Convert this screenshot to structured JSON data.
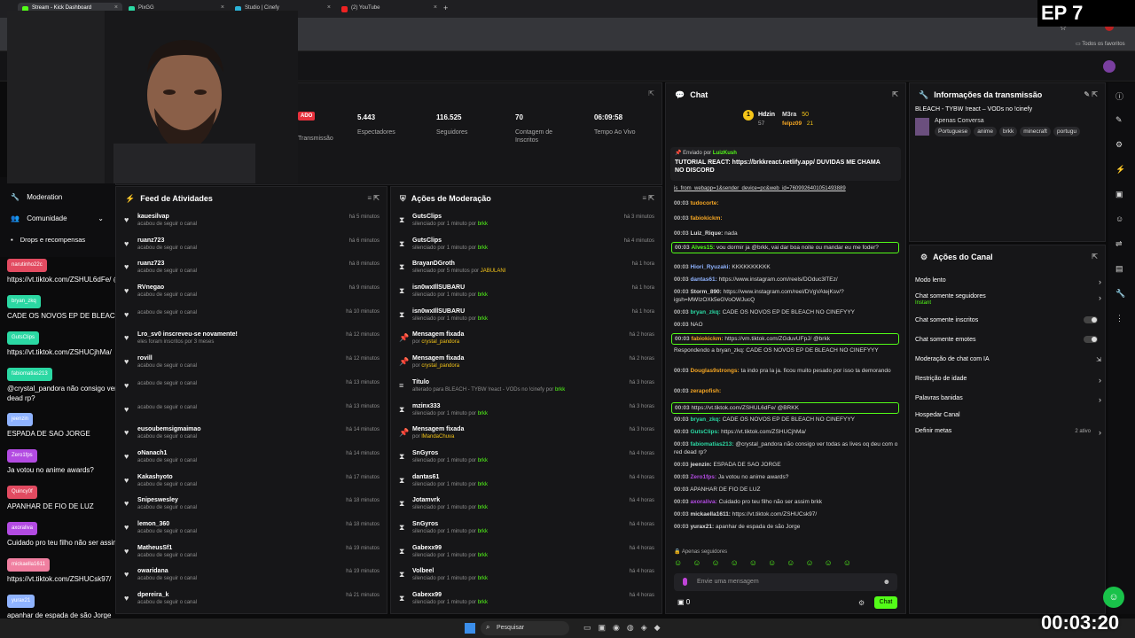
{
  "browser": {
    "tabs": [
      "Stream - Kick Dashboard",
      "PixGG",
      "Studio | Cinefy",
      "(2) YouTube"
    ],
    "bookmarks_label": "Todos os favoritos"
  },
  "overlay": {
    "episode": "EP 7",
    "timer": "00:03:20"
  },
  "stats": [
    {
      "value": "",
      "label": "Transmissão"
    },
    {
      "value": "5.443",
      "label": "Espectadores"
    },
    {
      "value": "116.525",
      "label": "Seguidores"
    },
    {
      "value": "70",
      "label": "Contagem de Inscritos"
    },
    {
      "value": "06:09:58",
      "label": "Tempo Ao Vivo"
    }
  ],
  "live_badge": "ADO",
  "left_nav": [
    {
      "label": "Moderation"
    },
    {
      "label": "Comunidade"
    },
    {
      "label": "Drops e recompensas"
    }
  ],
  "left_chat": [
    {
      "user": "narutinho22c",
      "msg": "https://vt.tiktok.com/ZSHUL6dFe/ @BRKK",
      "color": "#e24b61"
    },
    {
      "user": "bryan_zkq",
      "msg": "CADE OS NOVOS EP DE BLEACH NO CINEFYYY",
      "color": "#2bd8a3"
    },
    {
      "user": "GutsClips",
      "msg": "https://vt.tiktok.com/ZSHUCjhMa/",
      "color": "#2bd8a3"
    },
    {
      "user": "fabiomatias213",
      "msg": "@crystal_pandora não consigo ver todas as lives oq deu com o red dead rp?",
      "color": "#2bd8a3"
    },
    {
      "user": "jeenzin",
      "msg": "ESPADA DE SAO JORGE",
      "color": "#8fb3ff"
    },
    {
      "user": "Zero1fps",
      "msg": "Ja votou no anime awards?",
      "color": "#b34be2"
    },
    {
      "user": "Quincy0f",
      "msg": "APANHAR DE FIO DE LUZ",
      "color": "#e24b61"
    },
    {
      "user": "axoraliva",
      "msg": "Cuidado pro teu filho não ser assim brkk",
      "color": "#b34be2"
    },
    {
      "user": "mickaella1611",
      "msg": "https://vt.tiktok.com/ZSHUCsk97/",
      "color": "#f07fa0"
    },
    {
      "user": "yurax21",
      "msg": "apanhar de espada de são Jorge",
      "color": "#8fb3ff"
    }
  ],
  "feed": {
    "title": "Feed de Atividades",
    "items": [
      {
        "name": "kauesilvap",
        "sub": "acabou de seguir o canal",
        "time": "há 5 minutos"
      },
      {
        "name": "ruanz723",
        "sub": "acabou de seguir o canal",
        "time": "há 6 minutos"
      },
      {
        "name": "ruanz723",
        "sub": "acabou de seguir o canal",
        "time": "há 8 minutos"
      },
      {
        "name": "RVnegao",
        "sub": "acabou de seguir o canal",
        "time": "há 9 minutos"
      },
      {
        "name": "",
        "sub": "acabou de seguir o canal",
        "time": "há 10 minutos"
      },
      {
        "name": "Lro_sv0 inscreveu-se novamente!",
        "sub": "eles foram inscritos por 3 meses",
        "time": "há 12 minutos"
      },
      {
        "name": "rovill",
        "sub": "acabou de seguir o canal",
        "time": "há 12 minutos"
      },
      {
        "name": "",
        "sub": "acabou de seguir o canal",
        "time": "há 13 minutos"
      },
      {
        "name": "",
        "sub": "acabou de seguir o canal",
        "time": "há 13 minutos"
      },
      {
        "name": "eusoubemsigmaimao",
        "sub": "acabou de seguir o canal",
        "time": "há 14 minutos"
      },
      {
        "name": "oNanach1",
        "sub": "acabou de seguir o canal",
        "time": "há 14 minutos"
      },
      {
        "name": "Kakashyoto",
        "sub": "acabou de seguir o canal",
        "time": "há 17 minutos"
      },
      {
        "name": "Snipeswesley",
        "sub": "acabou de seguir o canal",
        "time": "há 18 minutos"
      },
      {
        "name": "lemon_360",
        "sub": "acabou de seguir o canal",
        "time": "há 18 minutos"
      },
      {
        "name": "MatheusSf1",
        "sub": "acabou de seguir o canal",
        "time": "há 19 minutos"
      },
      {
        "name": "owaridana",
        "sub": "acabou de seguir o canal",
        "time": "há 19 minutos"
      },
      {
        "name": "dpereira_k",
        "sub": "acabou de seguir o canal",
        "time": "há 21 minutos"
      }
    ]
  },
  "moderation": {
    "title": "Ações de Moderação",
    "items": [
      {
        "name": "GutsClips",
        "sub": "silenciado por 1 minuto por",
        "by": "brkk",
        "time": "há 3 minutos",
        "icon": "hourglass"
      },
      {
        "name": "GutsClips",
        "sub": "silenciado por 1 minuto por",
        "by": "brkk",
        "time": "há 4 minutos",
        "icon": "hourglass"
      },
      {
        "name": "BrayanDGroth",
        "sub": "silenciado por 5 minutos por",
        "by": "JABULANI",
        "time": "há 1 hora",
        "icon": "hourglass"
      },
      {
        "name": "isn0wxIllSUBARU",
        "sub": "silenciado por 1 minuto por",
        "by": "brkk",
        "time": "há 1 hora",
        "icon": "hourglass"
      },
      {
        "name": "isn0wxIllSUBARU",
        "sub": "silenciado por 1 minuto por",
        "by": "brkk",
        "time": "há 1 hora",
        "icon": "hourglass"
      },
      {
        "name": "Mensagem fixada",
        "sub": "por",
        "by": "crystal_pandora",
        "time": "há 2 horas",
        "icon": "pin"
      },
      {
        "name": "Mensagem fixada",
        "sub": "por",
        "by": "crystal_pandora",
        "time": "há 2 horas",
        "icon": "pin"
      },
      {
        "name": "Título",
        "sub": "alterado para BLEACH - TYBW !react - VODs no !cinefy por",
        "by": "brkk",
        "time": "há 3 horas",
        "icon": "title"
      },
      {
        "name": "mzinx333",
        "sub": "silenciado por 1 minuto por",
        "by": "brkk",
        "time": "há 3 horas",
        "icon": "hourglass"
      },
      {
        "name": "Mensagem fixada",
        "sub": "por",
        "by": "lMandaChuva",
        "time": "há 3 horas",
        "icon": "pin"
      },
      {
        "name": "SnGyros",
        "sub": "silenciado por 1 minuto por",
        "by": "brkk",
        "time": "há 4 horas",
        "icon": "hourglass"
      },
      {
        "name": "dantas61",
        "sub": "silenciado por 1 minuto por",
        "by": "brkk",
        "time": "há 4 horas",
        "icon": "hourglass"
      },
      {
        "name": "Jotamvrk",
        "sub": "silenciado por 1 minuto por",
        "by": "brkk",
        "time": "há 4 horas",
        "icon": "hourglass"
      },
      {
        "name": "SnGyros",
        "sub": "silenciado por 1 minuto por",
        "by": "brkk",
        "time": "há 4 horas",
        "icon": "hourglass"
      },
      {
        "name": "Gabexx99",
        "sub": "silenciado por 1 minuto por",
        "by": "brkk",
        "time": "há 4 horas",
        "icon": "hourglass"
      },
      {
        "name": "Volbeel",
        "sub": "silenciado por 1 minuto por",
        "by": "brkk",
        "time": "há 4 horas",
        "icon": "hourglass"
      },
      {
        "name": "Gabexx99",
        "sub": "silenciado por 1 minuto por",
        "by": "brkk",
        "time": "há 4 horas",
        "icon": "hourglass"
      }
    ]
  },
  "chat": {
    "title": "Chat",
    "leaders": [
      {
        "name": "Hdzin",
        "n": "57"
      },
      {
        "name": "M3ra",
        "n": "50"
      },
      {
        "name": "felpz09",
        "n": "21"
      }
    ],
    "pinned": {
      "label": "Enviado por",
      "by": "LuizKush",
      "text": "TUTORIAL REACT: https://brkkreact.netlify.app/ DUVIDAS ME CHAMA NO DISCORD"
    },
    "url_line": "is_from_webapp=1&sender_device=pc&web_id=7609926401051493889",
    "messages": [
      {
        "t": "00:03",
        "u": "tudocorte:",
        "c": "#f5a623",
        "m": "",
        "hl": false
      },
      {
        "t": "00:03",
        "u": "fabiokickm:",
        "c": "#f5a623",
        "m": "",
        "hl": false
      },
      {
        "t": "00:03",
        "u": "Luiz_Rique:",
        "c": "#ddd",
        "m": "nada",
        "hl": false
      },
      {
        "t": "00:03",
        "u": "Alves15:",
        "c": "#53fc18",
        "m": "vou dormir ja @brkk, vai dar boa noite ou mandar eu me foder?",
        "hl": true
      },
      {
        "t": "00:03",
        "u": "Hiori_Ryuzaki:",
        "c": "#8fb3ff",
        "m": "KKKKKKKKKK",
        "hl": false
      },
      {
        "t": "00:03",
        "u": "dantas61:",
        "c": "#8fb3ff",
        "m": "https://www.instagram.com/reels/DOduc3lTEz/",
        "hl": false
      },
      {
        "t": "00:03",
        "u": "Storm_890:",
        "c": "#ddd",
        "m": "https://www.instagram.com/reel/DVgVAtejKsv/?igsh=MWIzOXk5eGVoOWJucQ",
        "hl": false
      },
      {
        "t": "00:03",
        "u": "bryan_zkq:",
        "c": "#2bd8a3",
        "m": "CADE OS NOVOS EP DE BLEACH NO CINEFYYY",
        "hl": false
      },
      {
        "t": "00:03",
        "u": "",
        "c": "#e24b61",
        "m": "NAO",
        "hl": false
      },
      {
        "t": "00:03",
        "u": "fabiokickm:",
        "c": "#f5a623",
        "m": "https://vm.tiktok.com/ZGduvUFpJ/ @brkk",
        "hl": true
      },
      {
        "t": "",
        "u": "",
        "c": "#888",
        "m": "Respondendo a bryan_zkq: CADE OS NOVOS EP DE BLEACH NO CINEFYYY",
        "hl": false
      },
      {
        "t": "00:03",
        "u": "Douglas9strongs:",
        "c": "#f5a623",
        "m": "ta indo pra la ja. ficou muito pesado por isso ta demorando",
        "hl": false
      },
      {
        "t": "00:03",
        "u": "zerapofish:",
        "c": "#f5a623",
        "m": "",
        "hl": false
      },
      {
        "t": "00:03",
        "u": "",
        "c": "#e24b61",
        "m": "https://vt.tiktok.com/ZSHUL6dFe/ @BRKK",
        "hl": true
      },
      {
        "t": "00:03",
        "u": "bryan_zkq:",
        "c": "#2bd8a3",
        "m": "CADE OS NOVOS EP DE BLEACH NO CINEFYYY",
        "hl": false
      },
      {
        "t": "00:03",
        "u": "GutsClips:",
        "c": "#2bd8a3",
        "m": "https://vt.tiktok.com/ZSHUCjhMa/",
        "hl": false
      },
      {
        "t": "00:03",
        "u": "fabiomatias213:",
        "c": "#2bd8a3",
        "m": "@crystal_pandora não consigo ver todas as lives oq deu com o red dead rp?",
        "hl": false
      },
      {
        "t": "00:03",
        "u": "jeenzin:",
        "c": "#ddd",
        "m": "ESPADA DE SAO JORGE",
        "hl": false
      },
      {
        "t": "00:03",
        "u": "Zero1fps:",
        "c": "#b34be2",
        "m": "Ja votou no anime awards?",
        "hl": false
      },
      {
        "t": "00:03",
        "u": "",
        "c": "#e24b61",
        "m": "APANHAR DE FIO DE LUZ",
        "hl": false
      },
      {
        "t": "00:03",
        "u": "axoraliva:",
        "c": "#b34be2",
        "m": "Cuidado pro teu filho não ser assim brkk",
        "hl": false
      },
      {
        "t": "00:03",
        "u": "mickaella1611:",
        "c": "#ddd",
        "m": "https://vt.tiktok.com/ZSHUCsk97/",
        "hl": false
      },
      {
        "t": "00:03",
        "u": "yurax21:",
        "c": "#ddd",
        "m": "apanhar de espada de são Jorge",
        "hl": false
      }
    ],
    "followers_only": "Apenas seguidores",
    "placeholder": "Envie uma mensagem",
    "count": "0",
    "send": "Chat"
  },
  "stream_info": {
    "title": "Informações da transmissão",
    "stream_title": "BLEACH - TYBW !react – VODs no !cinefy",
    "category": "Apenas Conversa",
    "tags": [
      "Portuguese",
      "anime",
      "brkk",
      "minecraft",
      "portugu"
    ]
  },
  "channel_actions": {
    "title": "Ações do Canal",
    "rows": [
      {
        "label": "Modo lento",
        "kind": "arrow",
        "sub": ""
      },
      {
        "label": "Chat somente seguidores",
        "kind": "arrow",
        "sub": "Instant"
      },
      {
        "label": "Chat somente inscritos",
        "kind": "toggle",
        "sub": ""
      },
      {
        "label": "Chat somente emotes",
        "kind": "toggle",
        "sub": ""
      },
      {
        "label": "Moderação de chat com IA",
        "kind": "ext",
        "sub": ""
      },
      {
        "label": "Restrição de idade",
        "kind": "arrow",
        "sub": ""
      },
      {
        "label": "Palavras banidas",
        "kind": "arrow",
        "sub": ""
      },
      {
        "label": "Hospedar Canal",
        "kind": "none",
        "sub": ""
      },
      {
        "label": "Definir metas",
        "kind": "arrow",
        "sub": "2 ativo"
      }
    ]
  },
  "taskbar": {
    "search": "Pesquisar"
  },
  "colors": {
    "accent": "#53fc18",
    "panel": "#161618"
  }
}
